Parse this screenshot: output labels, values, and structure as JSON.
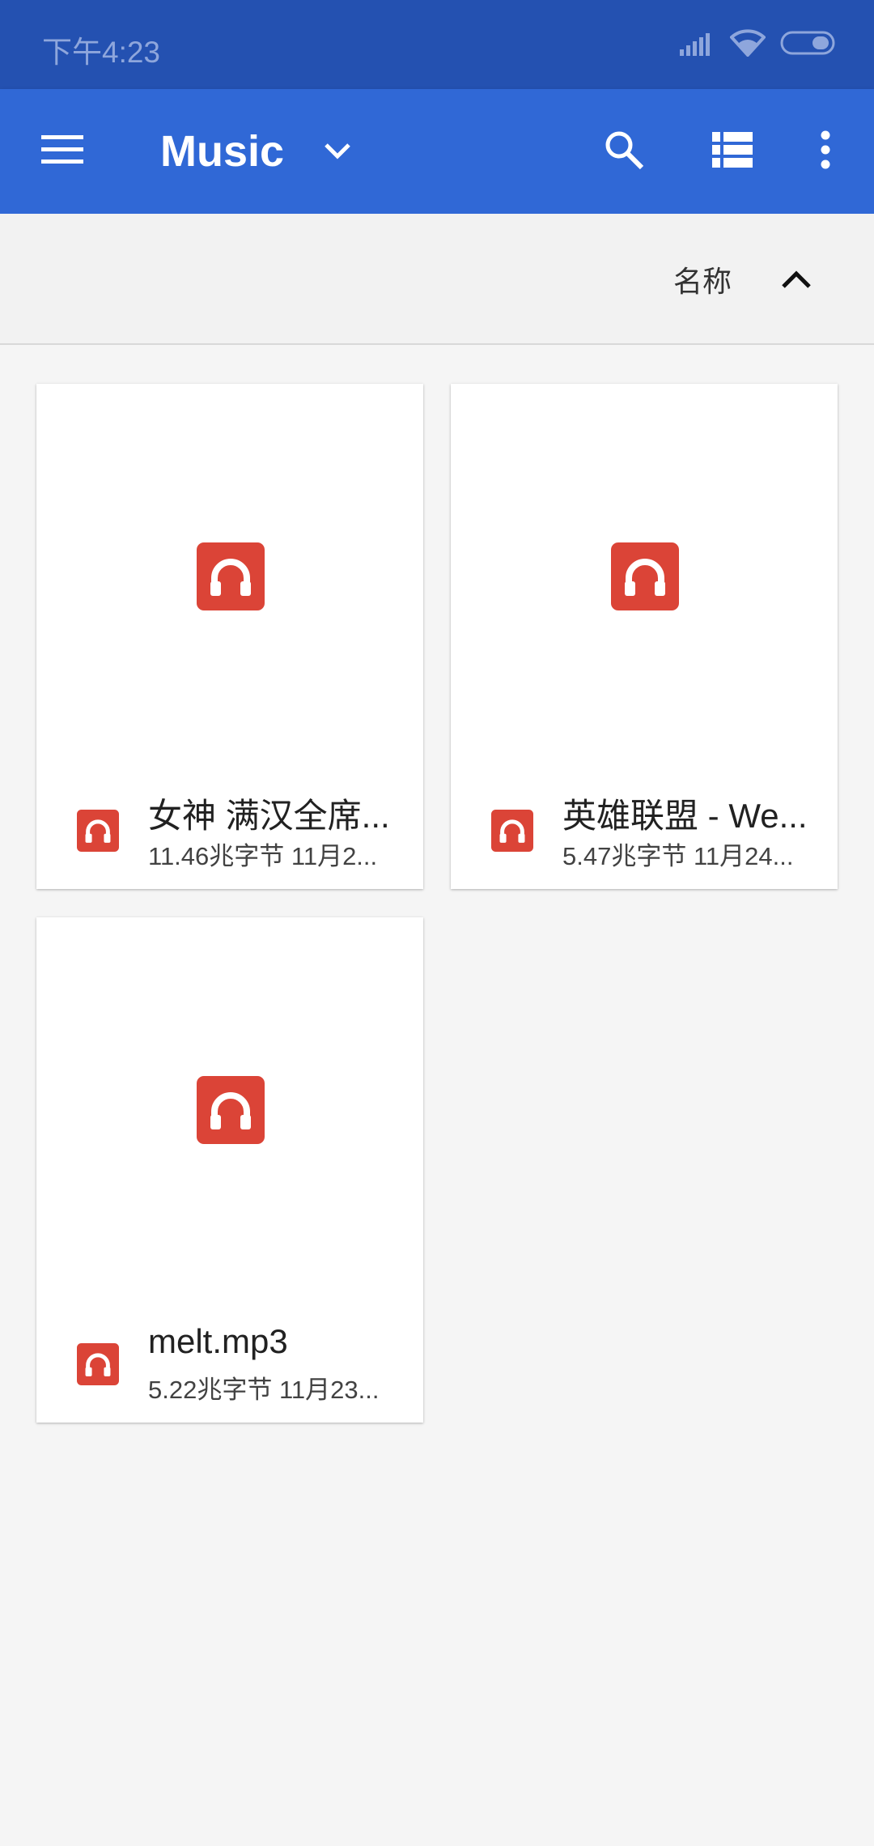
{
  "status_bar": {
    "time": "下午4:23",
    "icons": [
      "signal-icon",
      "wifi-icon",
      "battery-icon"
    ]
  },
  "app_bar": {
    "title": "Music",
    "icons": [
      "menu-icon",
      "chevron-down-icon",
      "search-icon",
      "list-view-icon",
      "more-vert-icon"
    ]
  },
  "sort_bar": {
    "label": "名称",
    "direction": "ascending"
  },
  "files": [
    {
      "name": "女神 满汉全席...",
      "meta": "11.46兆字节 11月2...",
      "icon": "headphones-icon"
    },
    {
      "name": "英雄联盟 - We...",
      "meta": "5.47兆字节 11月24...",
      "icon": "headphones-icon"
    },
    {
      "name": "melt.mp3",
      "meta": "5.22兆字节 11月23...",
      "icon": "headphones-icon"
    }
  ],
  "colors": {
    "status_bar": "#2451b1",
    "app_bar": "#3068d6",
    "audio_icon": "#db4437",
    "background": "#f5f5f5"
  }
}
